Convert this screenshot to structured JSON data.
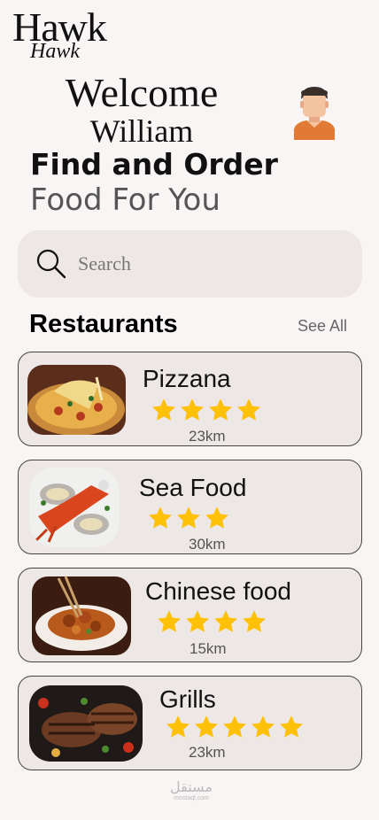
{
  "brand": {
    "logo_main": "Hawk",
    "logo_script": "Hawk"
  },
  "welcome": {
    "line1": "Welcome",
    "line2": "William"
  },
  "headline": {
    "line1": "Find and Order",
    "line2": "Food For You"
  },
  "search": {
    "placeholder": "Search",
    "icon": "search-icon"
  },
  "section": {
    "title": "Restaurants",
    "see_all": "See All"
  },
  "restaurants": [
    {
      "name": "Pizzana",
      "rating": 4,
      "distance": "23km",
      "image": "pizza-photo"
    },
    {
      "name": "Sea Food",
      "rating": 3,
      "distance": "30km",
      "image": "seafood-photo"
    },
    {
      "name": "Chinese food",
      "rating": 4,
      "distance": "15km",
      "image": "chinese-food-photo"
    },
    {
      "name": "Grills",
      "rating": 5,
      "distance": "23km",
      "image": "grilled-meat-photo"
    }
  ],
  "watermark": {
    "arabic": "مستقل",
    "latin": "mostaql.com"
  },
  "colors": {
    "background": "#f8f5f4",
    "card": "#ede7e6",
    "star": "#ffc107",
    "avatar_shirt": "#e07a34"
  }
}
